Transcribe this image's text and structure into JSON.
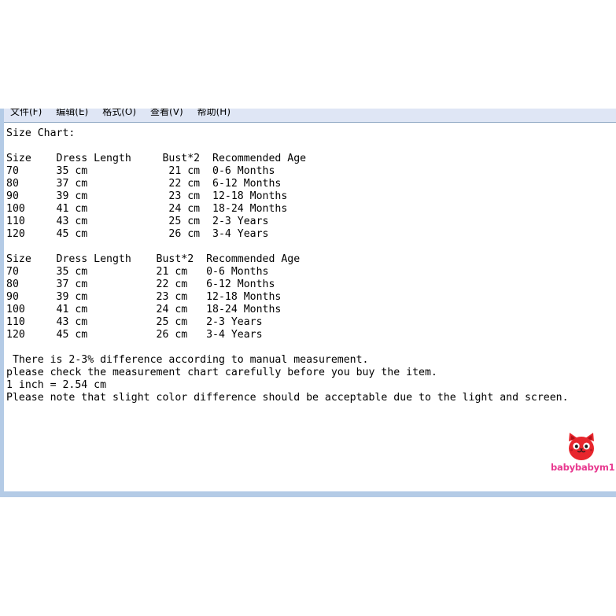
{
  "window": {
    "menu": [
      {
        "label": "文件(F)",
        "name": "menu-file"
      },
      {
        "label": "编辑(E)",
        "name": "menu-edit"
      },
      {
        "label": "格式(O)",
        "name": "menu-format"
      },
      {
        "label": "查看(V)",
        "name": "menu-view"
      },
      {
        "label": "帮助(H)",
        "name": "menu-help"
      }
    ]
  },
  "document": {
    "title": "Size Chart:",
    "table_headers": [
      "Size",
      "Dress Length",
      "Bust*2",
      "Recommended Age"
    ],
    "table_one": [
      {
        "size": "70",
        "dress_length": "35 cm",
        "bust": "21 cm",
        "age": "0-6 Months"
      },
      {
        "size": "80",
        "dress_length": "37 cm",
        "bust": "22 cm",
        "age": "6-12 Months"
      },
      {
        "size": "90",
        "dress_length": "39 cm",
        "bust": "23 cm",
        "age": "12-18 Months"
      },
      {
        "size": "100",
        "dress_length": "41 cm",
        "bust": "24 cm",
        "age": "18-24 Months"
      },
      {
        "size": "110",
        "dress_length": "43 cm",
        "bust": "25 cm",
        "age": "2-3 Years"
      },
      {
        "size": "120",
        "dress_length": "45 cm",
        "bust": "26 cm",
        "age": "3-4 Years"
      }
    ],
    "table_two": [
      {
        "size": "70",
        "dress_length": "35 cm",
        "bust": "21 cm",
        "age": "0-6 Months"
      },
      {
        "size": "80",
        "dress_length": "37 cm",
        "bust": "22 cm",
        "age": "6-12 Months"
      },
      {
        "size": "90",
        "dress_length": "39 cm",
        "bust": "23 cm",
        "age": "12-18 Months"
      },
      {
        "size": "100",
        "dress_length": "41 cm",
        "bust": "24 cm",
        "age": "18-24 Months"
      },
      {
        "size": "110",
        "dress_length": "43 cm",
        "bust": "25 cm",
        "age": "2-3 Years"
      },
      {
        "size": "120",
        "dress_length": "45 cm",
        "bust": "26 cm",
        "age": "3-4 Years"
      }
    ],
    "notes": [
      " There is 2-3% difference according to manual measurement.",
      "please check the measurement chart carefully before you buy the item.",
      "1 inch = 2.54 cm",
      "Please note that slight color difference should be acceptable due to the light and screen."
    ],
    "raw_text": "Size Chart:\n\nSize    Dress Length     Bust*2  Recommended Age\n70      35 cm             21 cm  0-6 Months\n80      37 cm             22 cm  6-12 Months\n90      39 cm             23 cm  12-18 Months\n100     41 cm             24 cm  18-24 Months\n110     43 cm             25 cm  2-3 Years\n120     45 cm             26 cm  3-4 Years\n\nSize    Dress Length    Bust*2  Recommended Age\n70      35 cm           21 cm   0-6 Months\n80      37 cm           22 cm   6-12 Months\n90      39 cm           23 cm   12-18 Months\n100     41 cm           24 cm   18-24 Months\n110     43 cm           25 cm   2-3 Years\n120     45 cm           26 cm   3-4 Years\n\n There is 2-3% difference according to manual measurement.\nplease check the measurement chart carefully before you buy the item.\n1 inch = 2.54 cm\nPlease note that slight color difference should be acceptable due to the light and screen."
  },
  "watermark": {
    "shop_name": "babybabym1",
    "logo_icon": "cat-face-icon",
    "logo_color": "#e8262d",
    "text_color": "#e8388f"
  },
  "colors": {
    "window_frame": "#b4cbe6",
    "menu_bar_bg": "#dfe6f5",
    "page_bg": "#ffffff",
    "text": "#000000"
  }
}
